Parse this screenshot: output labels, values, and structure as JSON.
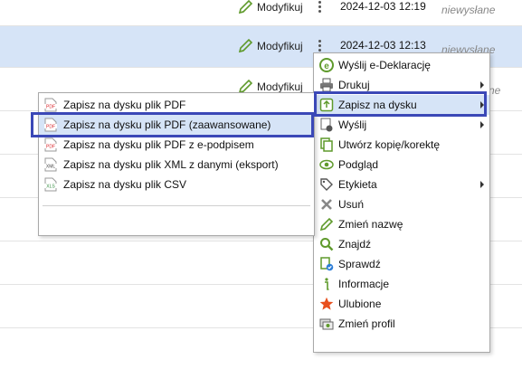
{
  "rows": [
    {
      "edit_label": "Modyfikuj",
      "date": "2024-12-03 12:19",
      "status": "niewysłane"
    },
    {
      "edit_label": "Modyfikuj",
      "date": "2024-12-03 12:13",
      "status": "niewysłane"
    },
    {
      "edit_label": "Modyfikuj",
      "status_partial": "ne"
    }
  ],
  "context_menu": {
    "items": [
      {
        "label": "Wyślij e-Deklarację",
        "icon": "e-declaration-icon"
      },
      {
        "label": "Drukuj",
        "icon": "printer-icon",
        "submenu": true
      },
      {
        "label": "Zapisz na dysku",
        "icon": "save-to-disk-icon",
        "submenu": true,
        "highlighted": true
      },
      {
        "label": "Wyślij",
        "icon": "send-icon",
        "submenu": true
      },
      {
        "label": "Utwórz kopię/korektę",
        "icon": "copy-icon"
      },
      {
        "label": "Podgląd",
        "icon": "eye-icon"
      },
      {
        "label": "Etykieta",
        "icon": "tag-icon",
        "submenu": true
      },
      {
        "label": "Usuń",
        "icon": "delete-x-icon"
      },
      {
        "label": "Zmień nazwę",
        "icon": "pencil-icon"
      },
      {
        "label": "Znajdź",
        "icon": "magnifier-icon"
      },
      {
        "label": "Sprawdź",
        "icon": "check-document-icon"
      },
      {
        "label": "Informacje",
        "icon": "info-icon"
      },
      {
        "label": "Ulubione",
        "icon": "star-icon"
      },
      {
        "label": "Zmień profil",
        "icon": "profile-icon"
      }
    ]
  },
  "save_submenu": {
    "items": [
      {
        "label": "Zapisz na dysku plik PDF",
        "icon": "pdf-file-icon",
        "badge": "PDF"
      },
      {
        "label": "Zapisz na dysku plik PDF (zaawansowane)",
        "icon": "pdf-file-icon",
        "badge": "PDF",
        "highlighted": true
      },
      {
        "label": "Zapisz na dysku plik PDF z e-podpisem",
        "icon": "pdf-file-icon",
        "badge": "PDF"
      },
      {
        "label": "Zapisz na dysku plik XML z danymi (eksport)",
        "icon": "xml-file-icon",
        "badge": "XML"
      },
      {
        "label": "Zapisz na dysku plik CSV",
        "icon": "xls-file-icon",
        "badge": "XLS"
      }
    ]
  },
  "colors": {
    "accent_green": "#5f9a2c",
    "highlight": "#d6e4f7",
    "callout": "#3b48b7"
  }
}
